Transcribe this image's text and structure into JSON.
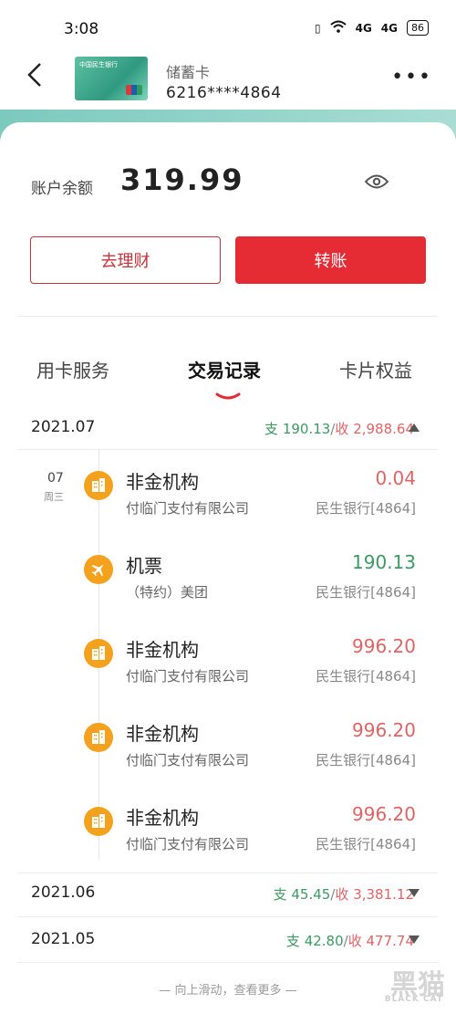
{
  "status": {
    "time": "3:08",
    "signal1": "4G",
    "signal2": "4G",
    "battery": "86"
  },
  "header": {
    "card_type": "储蓄卡",
    "card_number": "6216****4864",
    "bank_mini": "中国民生银行"
  },
  "balance": {
    "label": "账户余额",
    "value": "319.99"
  },
  "buttons": {
    "invest": "去理财",
    "transfer": "转账"
  },
  "tabs": [
    {
      "label": "用卡服务",
      "active": false
    },
    {
      "label": "交易记录",
      "active": true
    },
    {
      "label": "卡片权益",
      "active": false
    }
  ],
  "months": [
    {
      "month": "2021.07",
      "out_label": "支",
      "out": "190.13",
      "sep": "/",
      "in_label": "收",
      "in": "2,988.64",
      "expanded": true
    },
    {
      "month": "2021.06",
      "out_label": "支",
      "out": "45.45",
      "sep": "/",
      "in_label": "收",
      "in": "3,381.12",
      "expanded": false
    },
    {
      "month": "2021.05",
      "out_label": "支",
      "out": "42.80",
      "sep": "/",
      "in_label": "收",
      "in": "477.74",
      "expanded": false
    }
  ],
  "day": {
    "day": "07",
    "weekday": "周三"
  },
  "transactions": [
    {
      "title": "非金机构",
      "merchant": "付临门支付有限公司",
      "amount": "0.04",
      "type": "income",
      "account": "民生银行[4864]",
      "icon": "building-icon"
    },
    {
      "title": "机票",
      "merchant": "（特约）美团",
      "amount": "190.13",
      "type": "expense",
      "account": "民生银行[4864]",
      "icon": "airplane-icon"
    },
    {
      "title": "非金机构",
      "merchant": "付临门支付有限公司",
      "amount": "996.20",
      "type": "income",
      "account": "民生银行[4864]",
      "icon": "building-icon"
    },
    {
      "title": "非金机构",
      "merchant": "付临门支付有限公司",
      "amount": "996.20",
      "type": "income",
      "account": "民生银行[4864]",
      "icon": "building-icon"
    },
    {
      "title": "非金机构",
      "merchant": "付临门支付有限公司",
      "amount": "996.20",
      "type": "income",
      "account": "民生银行[4864]",
      "icon": "building-icon"
    }
  ],
  "footer": {
    "hint": "— 向上滑动，查看更多 —"
  },
  "watermark": {
    "text": "黑猫",
    "sub": "BLACK CAT"
  },
  "colors": {
    "expense": "#3c9a63",
    "income": "#e06466",
    "accent": "#e52b33",
    "icon_bg": "#f4a21d"
  }
}
